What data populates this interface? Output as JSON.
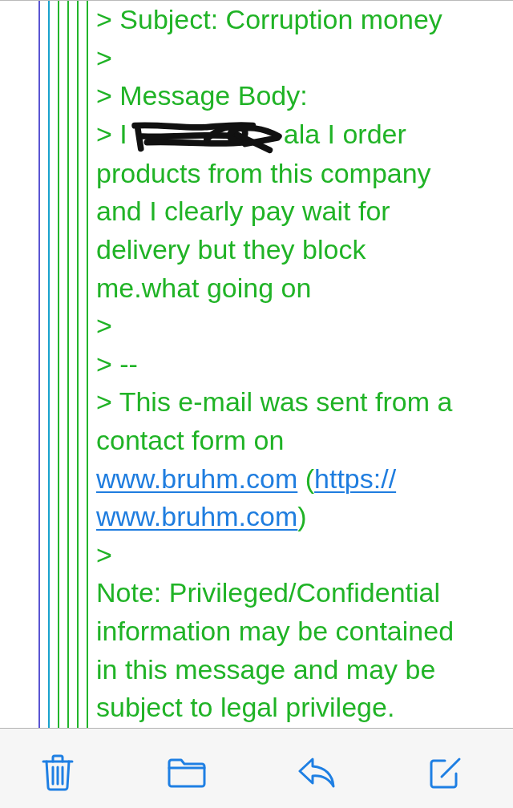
{
  "message": {
    "paragraphs": [
      {
        "segments": [
          {
            "kind": "text",
            "text": "> Subject: Corruption money"
          }
        ]
      },
      {
        "segments": [
          {
            "kind": "text",
            "text": ">"
          }
        ]
      },
      {
        "segments": [
          {
            "kind": "text",
            "text": "> Message Body:"
          }
        ]
      },
      {
        "segments": [
          {
            "kind": "text",
            "text": "> I"
          },
          {
            "kind": "redaction"
          },
          {
            "kind": "text",
            "text": "ala I order products from this company and I clearly pay wait for delivery but they block me.what going on"
          }
        ]
      },
      {
        "segments": [
          {
            "kind": "text",
            "text": ">"
          }
        ]
      },
      {
        "segments": [
          {
            "kind": "text",
            "text": "> --"
          }
        ]
      },
      {
        "segments": [
          {
            "kind": "text",
            "text": "> This e-mail was sent from a contact form on "
          },
          {
            "kind": "link",
            "text": "www.bruhm.com"
          },
          {
            "kind": "text",
            "text": " ("
          },
          {
            "kind": "link",
            "text": "https://"
          },
          {
            "kind": "link",
            "text": "www.bruhm.com"
          },
          {
            "kind": "text",
            "text": ")"
          }
        ]
      },
      {
        "segments": [
          {
            "kind": "text",
            "text": ">"
          }
        ]
      },
      {
        "segments": [
          {
            "kind": "text",
            "text": "Note: Privileged/Confidential information may be contained in this message and may be subject to legal privilege."
          }
        ]
      }
    ]
  },
  "toolbar": {
    "buttons": [
      {
        "kind": "delete"
      },
      {
        "kind": "move"
      },
      {
        "kind": "reply"
      },
      {
        "kind": "compose"
      }
    ]
  }
}
